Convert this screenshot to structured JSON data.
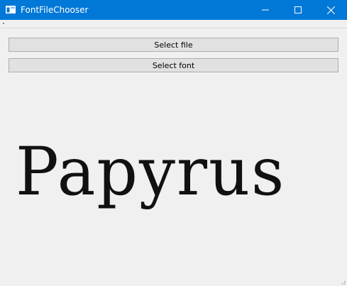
{
  "window": {
    "title": "FontFileChooser",
    "title_bar_color": "#0078d7",
    "icons": [
      "app-window-icon",
      "minimize-icon",
      "maximize-icon",
      "close-icon",
      "resize-grip-icon"
    ]
  },
  "buttons": {
    "select_file": "Select file",
    "select_font": "Select font"
  },
  "preview": {
    "text": "Papyrus"
  }
}
